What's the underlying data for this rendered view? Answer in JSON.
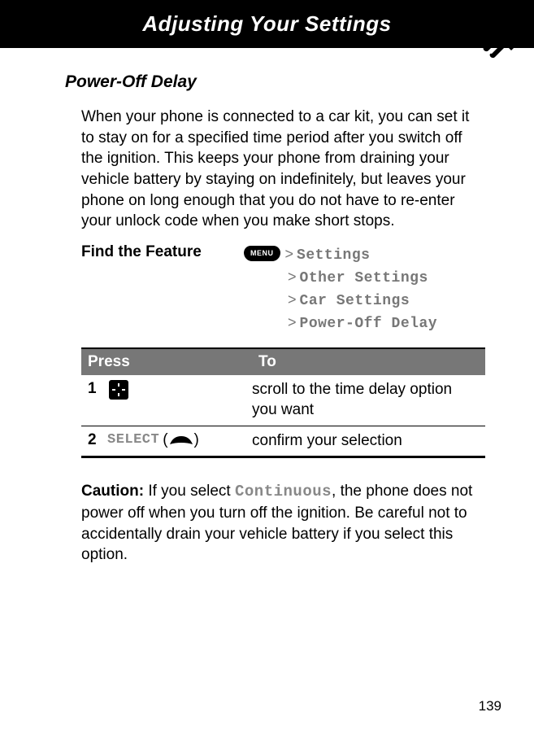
{
  "header": {
    "title": "Adjusting Your Settings"
  },
  "section": {
    "title": "Power-Off Delay"
  },
  "intro": "When your phone is connected to a car kit, you can set it to stay on for a specified time period after you switch off the ignition. This keeps your phone from draining your vehicle battery by staying on indefinitely, but leaves your phone on long enough that you do not have to re-enter your unlock code when you make short stops.",
  "find_feature": {
    "label": "Find the Feature",
    "menu_key": "MENU",
    "path": [
      "Settings",
      "Other Settings",
      "Car Settings",
      "Power-Off Delay"
    ]
  },
  "steps": {
    "headers": {
      "press": "Press",
      "to": "To"
    },
    "rows": [
      {
        "num": "1",
        "press_icon": "dpad",
        "press_text": "",
        "to": "scroll to the time delay option you want"
      },
      {
        "num": "2",
        "press_icon": "softkey",
        "press_text": "SELECT",
        "to": "confirm your selection"
      }
    ]
  },
  "caution": {
    "label": "Caution:",
    "before": " If you select ",
    "code": "Continuous",
    "after": ", the phone does not power off when you turn off the ignition. Be careful not to accidentally drain your vehicle battery if you select this option."
  },
  "page_number": "139"
}
